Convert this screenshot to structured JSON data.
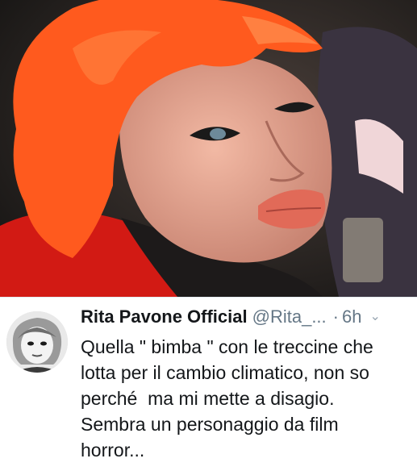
{
  "tweet": {
    "name": "Rita Pavone Official",
    "handle": "@Rita_...",
    "separator": "·",
    "time": "6h",
    "text": "Quella \" bimba \" con le treccine che\nlotta per il cambio climatico, non so\nperché  ma mi mette a disagio.\nSembra un personaggio da film\nhorror..."
  },
  "icons": {
    "menu": "chevron-down-icon"
  },
  "colors": {
    "name": "#14171a",
    "secondary": "#657786",
    "hair": "#ff5a1e",
    "scarf": "#d21a14"
  }
}
